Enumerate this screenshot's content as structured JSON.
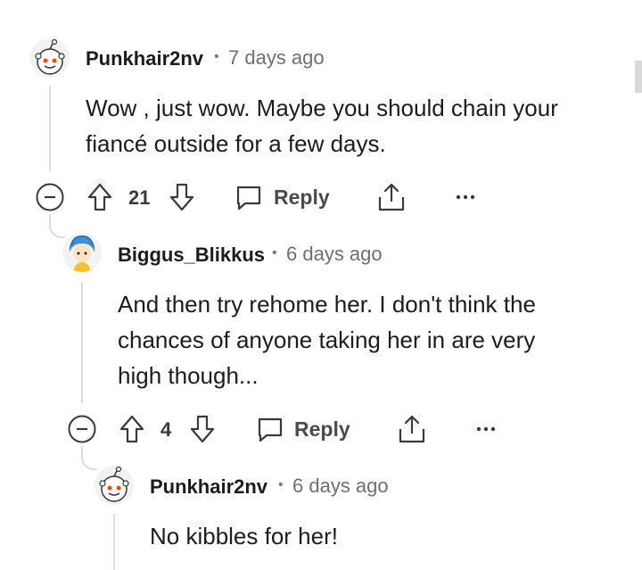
{
  "comments": [
    {
      "username": "Punkhair2nv",
      "separator": "•",
      "time": "7 days ago",
      "lines": [
        "Wow , just wow. Maybe you should chain your",
        "fiancé outside for a few days."
      ],
      "votes": "21",
      "reply_label": "Reply"
    },
    {
      "username": "Biggus_Blikkus",
      "separator": "•",
      "time": "6 days ago",
      "lines": [
        "And then try rehome her. I don't think the",
        "chances of anyone taking her in are very",
        "high though..."
      ],
      "votes": "4",
      "reply_label": "Reply"
    },
    {
      "username": "Punkhair2nv",
      "separator": "•",
      "time": "6 days ago",
      "lines": [
        "No kibbles for her!"
      ]
    }
  ],
  "icons": {
    "collapse": "collapse-minus-icon",
    "upvote": "upvote-arrow-icon",
    "downvote": "downvote-arrow-icon",
    "reply": "reply-bubble-icon",
    "share": "share-icon",
    "more": "more-dots-icon"
  },
  "colors": {
    "snoo_accent": "#ff4500",
    "blue_avatar": "#3a8fd6",
    "thread_line": "#dcdcdc"
  }
}
